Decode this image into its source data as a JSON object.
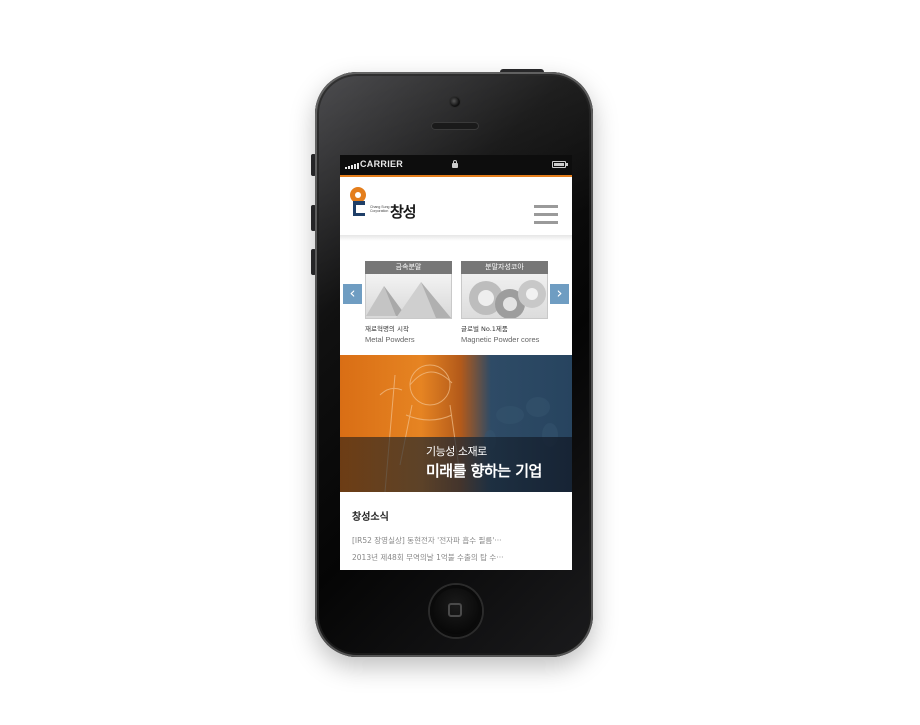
{
  "statusbar": {
    "carrier": "CARRIER"
  },
  "header": {
    "logo_text": "창성",
    "logo_subtext": "Chang Sung Corporation"
  },
  "products": [
    {
      "label": "금속분말",
      "title": "재료혁명의 시작",
      "subtitle": "Metal Powders"
    },
    {
      "label": "분말자성코아",
      "title": "글로벌 No.1제품",
      "subtitle": "Magnetic Powder cores"
    }
  ],
  "banner": {
    "line1": "기능성 소재로",
    "line2": "미래를 향하는 기업"
  },
  "news": {
    "heading": "창성소식",
    "items": [
      "[IR52 장영실상] 동현전자 '전자파 흡수 필름'···",
      "2013년 제48회 무역의날 1억불 수출의 탑 수···"
    ]
  },
  "colors": {
    "accent": "#e47e1c",
    "arrow": "#6f9dc2",
    "banner_blue": "#27445f"
  }
}
